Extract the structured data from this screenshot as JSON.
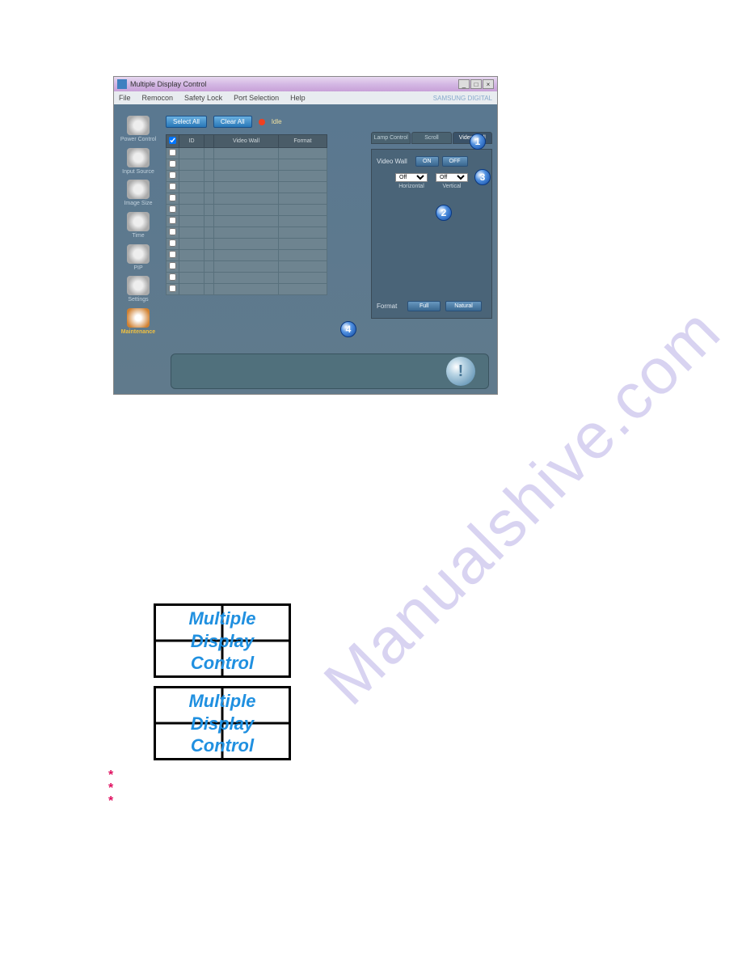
{
  "window": {
    "title": "Multiple Display Control",
    "min": "_",
    "max": "□",
    "close": "×"
  },
  "menu": {
    "file": "File",
    "remocon": "Remocon",
    "safety": "Safety Lock",
    "port": "Port Selection",
    "help": "Help",
    "brand": "SAMSUNG DIGITAL"
  },
  "sidebar": {
    "power": "Power Control",
    "input": "Input Source",
    "image": "Image Size",
    "time": "Time",
    "pip": "PIP",
    "settings": "Settings",
    "maintenance": "Maintenance"
  },
  "toolbar": {
    "select_all": "Select All",
    "clear_all": "Clear All",
    "idle": "Idle"
  },
  "table": {
    "col_id": "ID",
    "col_vw": "Video Wall",
    "col_fmt": "Format"
  },
  "tabs": {
    "lamp": "Lamp Control",
    "scroll": "Scroll",
    "vw": "Video Wall"
  },
  "panel": {
    "vw_label": "Video Wall",
    "on": "ON",
    "off": "OFF",
    "h_sel": "Off",
    "v_sel": "Off",
    "h_lbl": "Horizontal",
    "v_lbl": "Vertical",
    "format": "Format",
    "full": "Full",
    "natural": "Natural"
  },
  "callouts": {
    "c1": "1",
    "c2": "2",
    "c3": "3",
    "c4": "4"
  },
  "gridtext1": "Multiple Display Control",
  "gridtext2": "Multiple Display Control",
  "star": "*"
}
